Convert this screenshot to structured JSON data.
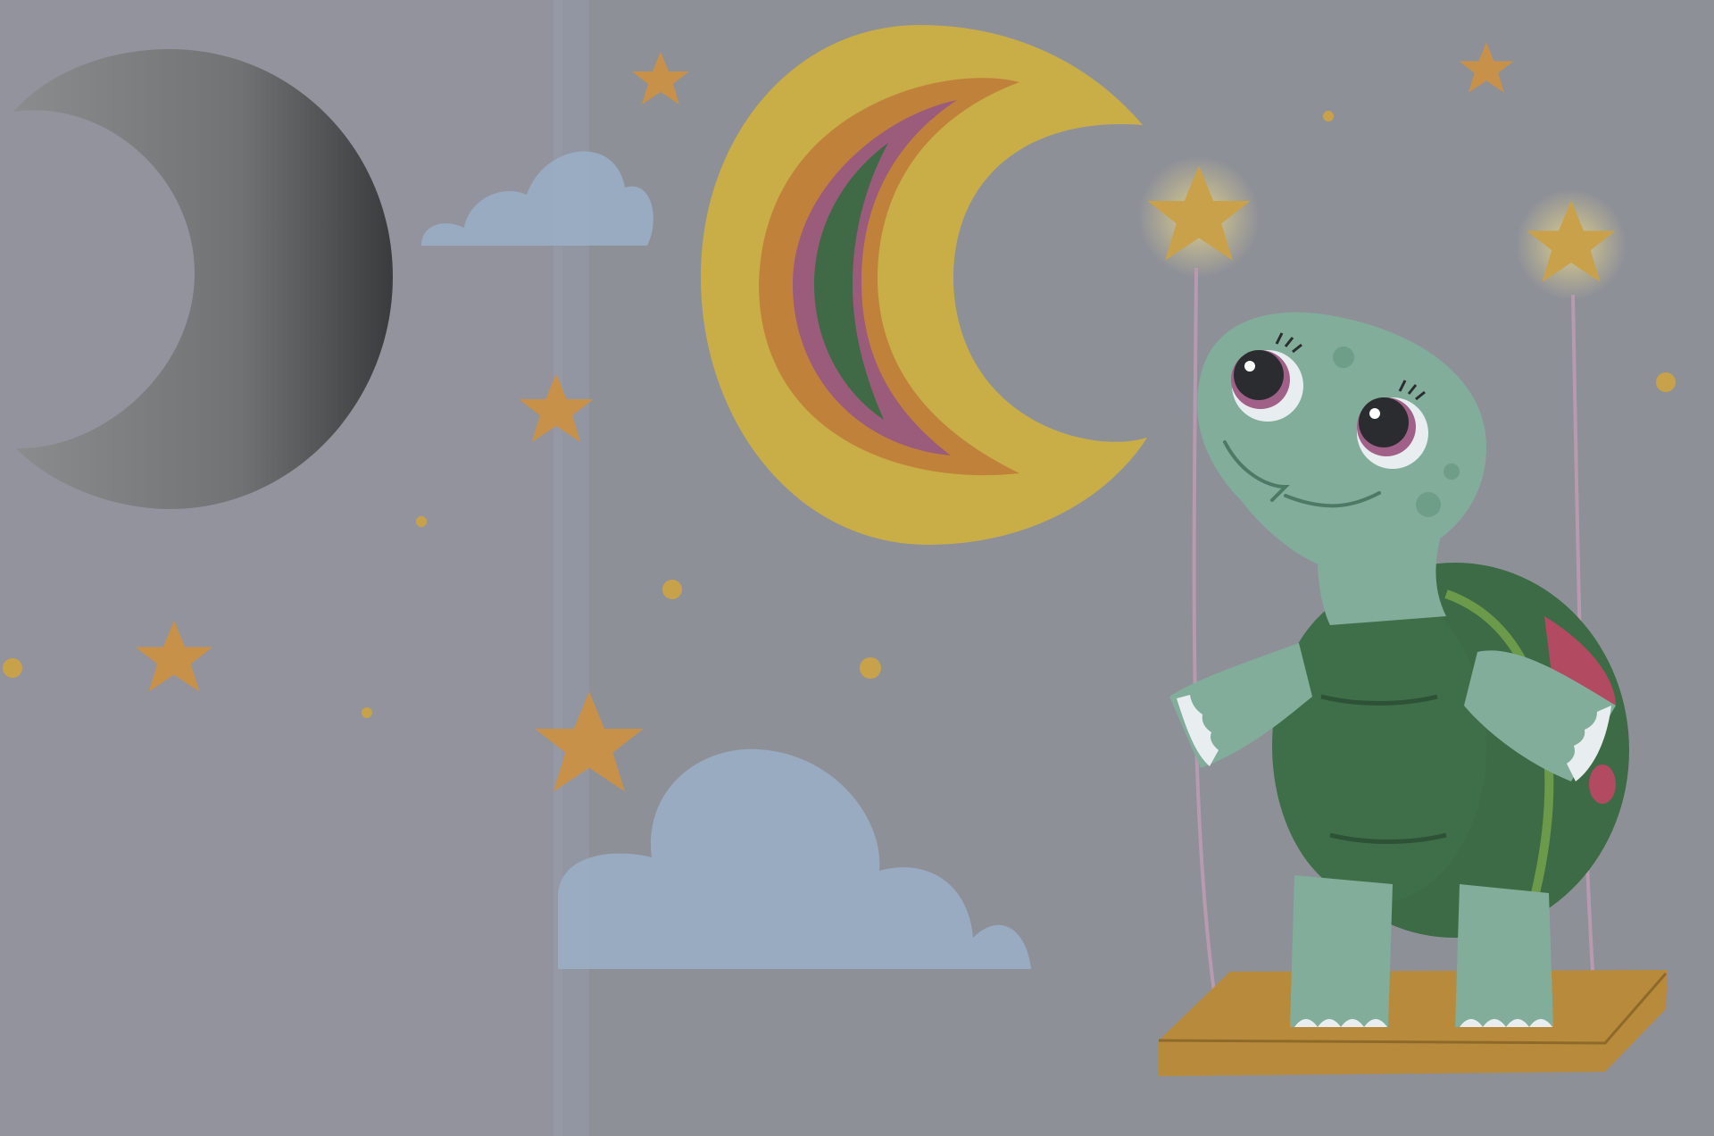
{
  "scene": {
    "description_tags": [
      "board-book-page",
      "night-sky"
    ],
    "colors": {
      "paper": "#8e9098",
      "paper_left": "#9496a0",
      "fold": "#9aa3b4",
      "star": "#c8914a",
      "star_glow": "#c9b36a",
      "dot": "#c8a24a",
      "cloud": "#9aaec4",
      "moon_hole": "#6e7072",
      "moon_yellow": "#c9ae47",
      "moon_orange": "#c0823a",
      "moon_pink": "#9a5c7a",
      "moon_green": "#3f6a45",
      "turtle_skin": "#82ad9a",
      "turtle_shell": "#3d6b45",
      "turtle_shell_rim": "#6a9a4a",
      "turtle_spot": "#b24a62",
      "swing_seat": "#b88a3c",
      "rope": "#b89ab0"
    },
    "icons": [
      "crescent-moon-cutout-icon",
      "crescent-moon-icon",
      "star-icon",
      "cloud-icon",
      "turtle-icon",
      "swing-icon"
    ]
  }
}
